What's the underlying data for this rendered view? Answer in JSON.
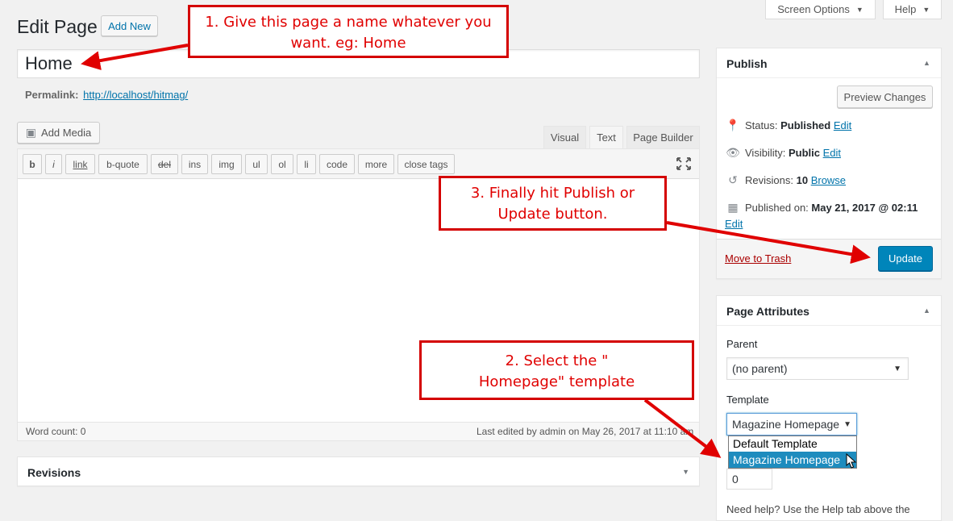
{
  "header": {
    "title": "Edit Page",
    "add_new": "Add New",
    "screen_options": "Screen Options",
    "help": "Help"
  },
  "post": {
    "title_value": "Home",
    "permalink_label": "Permalink:",
    "permalink_url": "http://localhost/hitmag/"
  },
  "editor": {
    "add_media": "Add Media",
    "tabs": [
      "Visual",
      "Text",
      "Page Builder"
    ],
    "active_tab": "Text",
    "quicktags": [
      "b",
      "i",
      "link",
      "b-quote",
      "del",
      "ins",
      "img",
      "ul",
      "ol",
      "li",
      "code",
      "more",
      "close tags"
    ],
    "word_count": "Word count: 0",
    "last_edited": "Last edited by admin on May 26, 2017 at 11:10 am"
  },
  "revisions_box": {
    "title": "Revisions"
  },
  "publish": {
    "title": "Publish",
    "preview": "Preview Changes",
    "status_label": "Status:",
    "status_value": "Published",
    "visibility_label": "Visibility:",
    "visibility_value": "Public",
    "revisions_label": "Revisions:",
    "revisions_value": "10",
    "browse": "Browse",
    "published_on_label": "Published on:",
    "published_on_value": "May 21, 2017 @ 02:11",
    "edit": "Edit",
    "move_to_trash": "Move to Trash",
    "update": "Update"
  },
  "page_attributes": {
    "title": "Page Attributes",
    "parent_label": "Parent",
    "parent_value": "(no parent)",
    "template_label": "Template",
    "template_value": "Magazine Homepage",
    "template_options": [
      "Default Template",
      "Magazine Homepage"
    ],
    "order_value": "0",
    "help_text": "Need help? Use the Help tab above the"
  },
  "annotations": {
    "step1": "1. Give this page a name whatever you want. eg: Home",
    "step2_line1": "2. Select the \"",
    "step2_line2": "Homepage\" template",
    "step3_line1": "3. Finally hit Publish or",
    "step3_line2": "Update button.",
    "color": "#e00000"
  },
  "colors": {
    "primary": "#0085ba",
    "link": "#0073aa",
    "trash": "#a00",
    "highlight": "#1e8cbe"
  }
}
